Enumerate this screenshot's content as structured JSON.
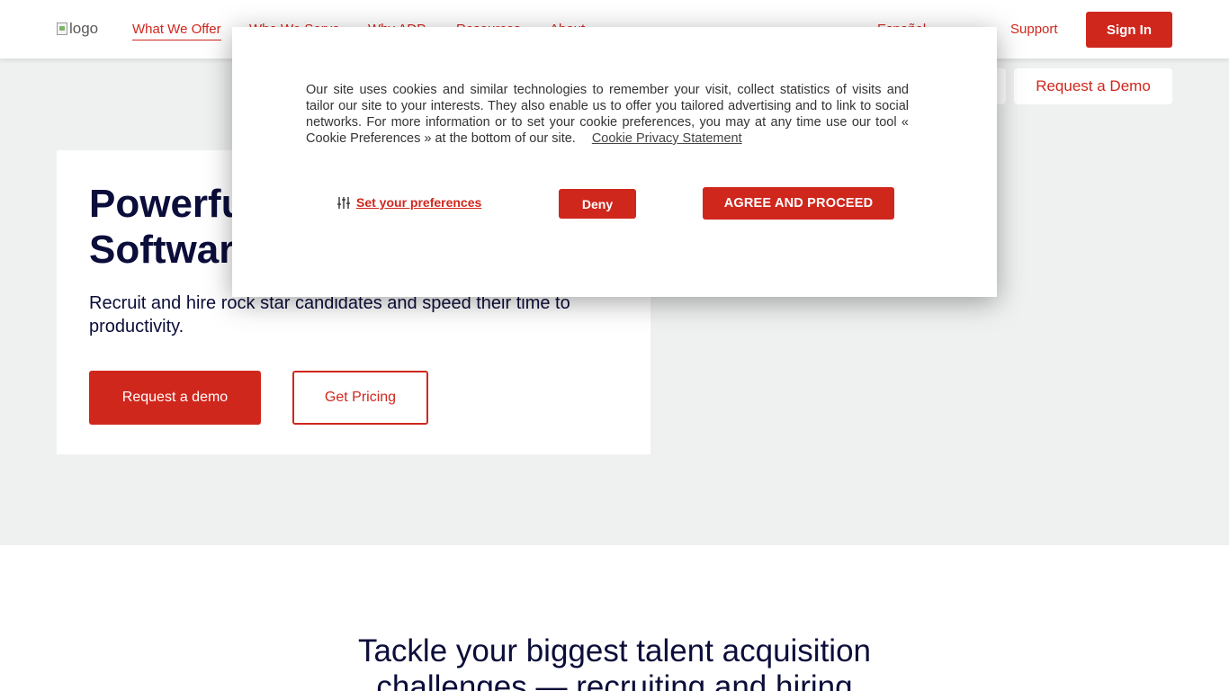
{
  "header": {
    "logo_alt": "logo",
    "nav": [
      {
        "label": "What We Offer",
        "active": true
      },
      {
        "label": "Who We Serve"
      },
      {
        "label": "Why ADP"
      },
      {
        "label": "Resources"
      },
      {
        "label": "About"
      },
      {
        "label": "Español"
      }
    ],
    "support_label": "Support",
    "signin_label": "Sign In",
    "request_demo_label": "Request a Demo"
  },
  "hero": {
    "title": "Powerful Recruiting Software",
    "subtitle": "Recruit and hire rock star candidates and speed their time to productivity.",
    "demo_button": "Request a demo",
    "pricing_button": "Get Pricing"
  },
  "section2": {
    "title_line1": "Tackle your biggest talent acquisition",
    "title_line2": "challenges — recruiting and hiring"
  },
  "cookie": {
    "text": "Our site uses cookies and similar technologies to remember your visit, collect statistics of visits and tailor our site to your interests. They also enable us to offer you tailored advertising and to link to social networks. For more information or to set your cookie preferences, you may at any time use our tool « Cookie Preferences » at the bottom of our site.",
    "privacy_link": "Cookie Privacy Statement",
    "preferences_label": "Set your preferences",
    "preferences_icon": "sliders-icon",
    "deny_label": "Deny",
    "agree_label": "AGREE AND PROCEED"
  },
  "colors": {
    "brand_red": "#d0271d",
    "navy_text": "#0b0d3a",
    "hero_bg": "#eff1f0"
  }
}
